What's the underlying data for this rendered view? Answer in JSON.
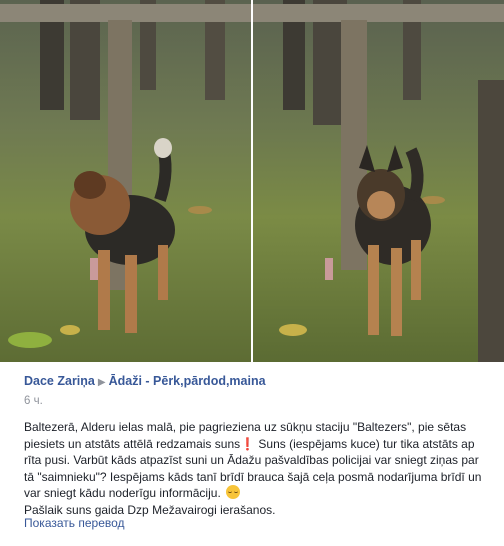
{
  "post": {
    "author": "Dace Zariņa",
    "arrow": "▶",
    "group": "Ādaži - Pērk,pārdod,maina",
    "timestamp": "6 ч.",
    "paragraph1_a": "Baltezerā, Alderu ielas malā, pie pagrieziena uz sūkņu staciju \"Baltezers\", pie sētas piesiets un atstāts attēlā redzamais suns",
    "red_mark": "❗",
    "paragraph1_b": " Suns (iespējams kuce) tur tika atstāts ap rīta pusi. Varbūt kāds atpazīst suni un Ādažu pašvaldības policijai var sniegt ziņas par tā \"saimnieku\"? Iespējams kāds tanī brīdī brauca šajā ceļa posmā nodarījuma brīdī un var sniegt kādu noderīgu informāciju.",
    "paragraph2": "Pašlaik suns gaida Dzp Mežavairogi ierašanos.",
    "translate_link": "Показать перевод"
  },
  "icons": {
    "sad_emoji": "pensive-face-icon"
  },
  "colors": {
    "link": "#385898",
    "text": "#1d2129",
    "muted": "#90949c",
    "alert": "#e0231c"
  }
}
